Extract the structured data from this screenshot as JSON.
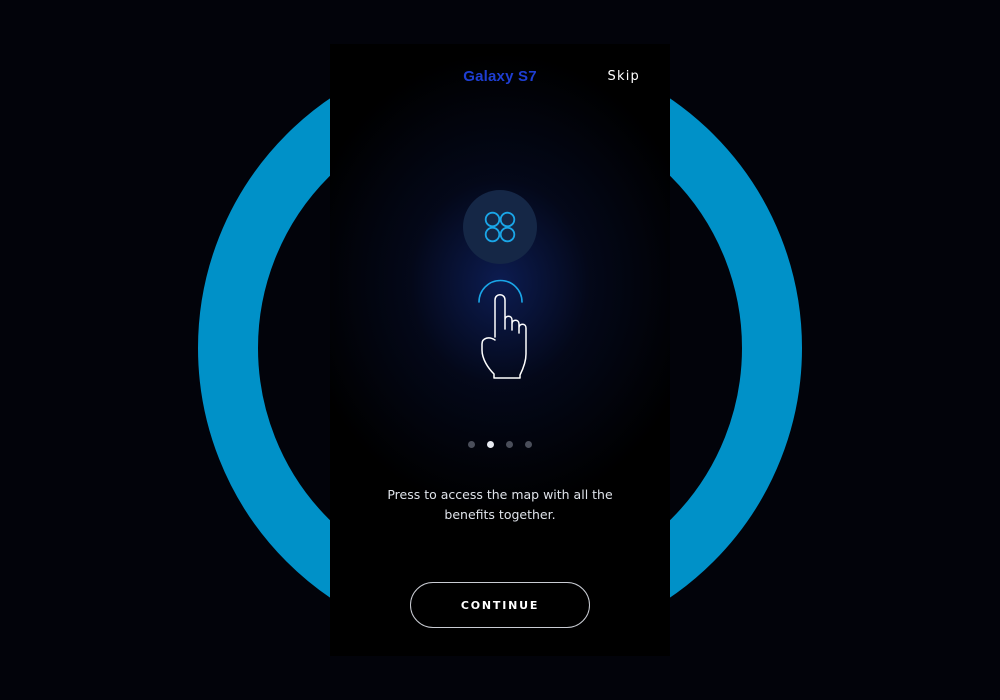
{
  "header": {
    "brand": "Galaxy S7",
    "skip_label": "Skip"
  },
  "illustration": {
    "top_icon": "apps-grid-icon",
    "bottom_icon": "hand-tap-icon"
  },
  "pagination": {
    "total": 4,
    "active_index": 1
  },
  "description": "Press to access the map with all the benefits together.",
  "continue_label": "CONTINUE",
  "colors": {
    "ring": "#0091c8",
    "brand": "#1e3ed2",
    "accent_icon": "#1aa6e8",
    "background": "#02030a"
  }
}
